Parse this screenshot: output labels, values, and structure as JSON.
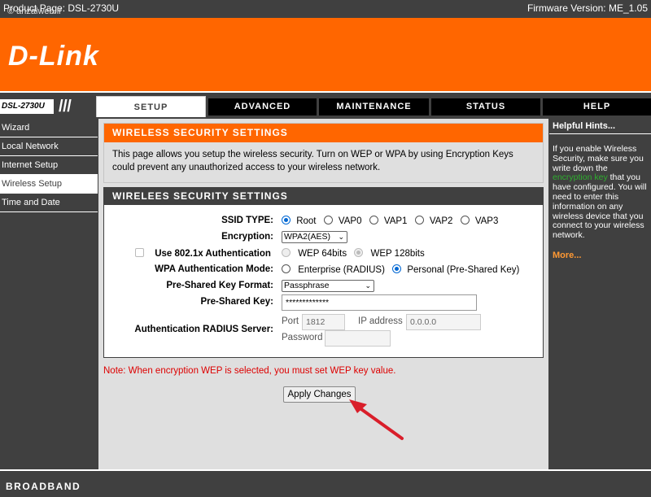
{
  "topbar": {
    "product_page": "Product Page: DSL-2730U",
    "firmware": "Firmware Version: ME_1.05",
    "watermark": "© anzalweb.ir"
  },
  "header": {
    "logo": "D-Link",
    "brand_color": "#ff6600"
  },
  "nav": {
    "model": "DSL-2730U",
    "tabs": [
      {
        "label": "SETUP",
        "active": true
      },
      {
        "label": "ADVANCED",
        "active": false
      },
      {
        "label": "MAINTENANCE",
        "active": false
      },
      {
        "label": "STATUS",
        "active": false
      },
      {
        "label": "HELP",
        "active": false
      }
    ]
  },
  "sidebar": {
    "items": [
      {
        "label": "Wizard",
        "active": false
      },
      {
        "label": "Local Network",
        "active": false
      },
      {
        "label": "Internet Setup",
        "active": false
      },
      {
        "label": "Wireless Setup",
        "active": true
      },
      {
        "label": "Time and Date",
        "active": false
      }
    ]
  },
  "intro": {
    "title": "WIRELESS SECURITY SETTINGS",
    "description": "This page allows you setup the wireless security. Turn on WEP or WPA by using Encryption Keys could prevent any unauthorized access to your wireless network."
  },
  "settings": {
    "title": "WIRELEES SECURITY SETTINGS",
    "ssid_type_label": "SSID TYPE:",
    "ssid_options": [
      "Root",
      "VAP0",
      "VAP1",
      "VAP2",
      "VAP3"
    ],
    "ssid_selected": "Root",
    "encryption_label": "Encryption:",
    "encryption_value": "WPA2(AES)",
    "use_8021x_label": "Use 802.1x Authentication",
    "wep64_label": "WEP 64bits",
    "wep128_label": "WEP 128bits",
    "wpa_auth_mode_label": "WPA Authentication Mode:",
    "wpa_auth_options": [
      "Enterprise (RADIUS)",
      "Personal (Pre-Shared Key)"
    ],
    "wpa_auth_selected": "Personal (Pre-Shared Key)",
    "psk_format_label": "Pre-Shared Key Format:",
    "psk_format_value": "Passphrase",
    "psk_label": "Pre-Shared Key:",
    "psk_value": "*************",
    "radius_label": "Authentication RADIUS Server:",
    "port_label": "Port",
    "port_value": "1812",
    "ip_label": "IP address",
    "ip_value": "0.0.0.0",
    "password_label": "Password",
    "password_value": ""
  },
  "note": "Note: When encryption WEP is selected, you must set WEP key value.",
  "apply_label": "Apply Changes",
  "hints": {
    "title": "Helpful Hints...",
    "text_before": "If you enable Wireless Security, make sure you write down the ",
    "highlight": "encryption key",
    "text_after": " that you have configured. You will need to enter this information on any wireless device that you connect to your wireless network.",
    "more": "More..."
  },
  "footer": {
    "brand": "BROADBAND"
  }
}
